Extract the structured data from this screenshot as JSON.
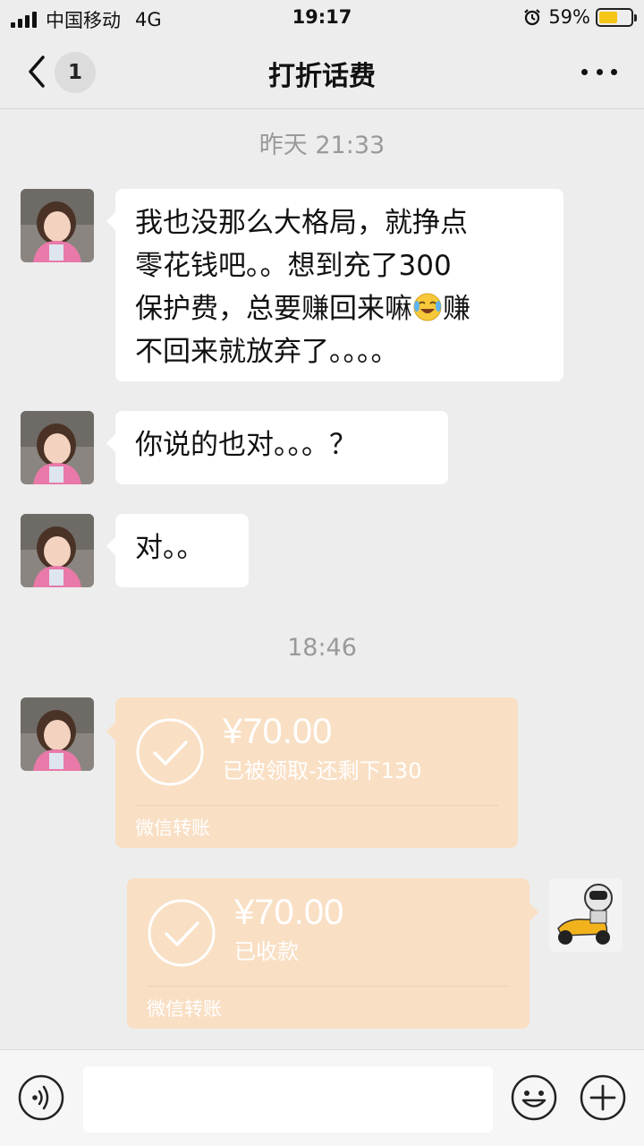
{
  "status_bar": {
    "carrier": "中国移动",
    "network": "4G",
    "time": "19:17",
    "battery_percent": "59%",
    "battery_level": 0.59,
    "battery_color": "#f5c518"
  },
  "nav": {
    "unread_count": "1",
    "title": "打折话费",
    "back_icon": "chevron-left-icon",
    "more_icon": "more-dots-icon"
  },
  "messages": {
    "timestamp_1": "昨天 21:33",
    "msg_1_lines": [
      "我也没那么大格局，就挣点",
      "零花钱吧。。想到充了300",
      "保护费，总要赚回来嘛",
      "不回来就放弃了。。。。"
    ],
    "msg_1_line3_tail": "赚",
    "msg_1_emoji": "crying-laughing-emoji",
    "msg_2": "你说的也对。。。？",
    "msg_3": "对。。",
    "timestamp_2": "18:46",
    "transfer_1": {
      "amount": "¥70.00",
      "status": "已被领取-还剩下130",
      "label": "微信转账"
    },
    "transfer_2": {
      "amount": "¥70.00",
      "status": "已收款",
      "label": "微信转账"
    }
  },
  "colors": {
    "background": "#ededed",
    "transfer_card": "#f9dfc4",
    "bubble": "#ffffff"
  },
  "input_bar": {
    "voice_icon": "voice-icon",
    "emoji_icon": "emoji-icon",
    "plus_icon": "plus-icon"
  }
}
